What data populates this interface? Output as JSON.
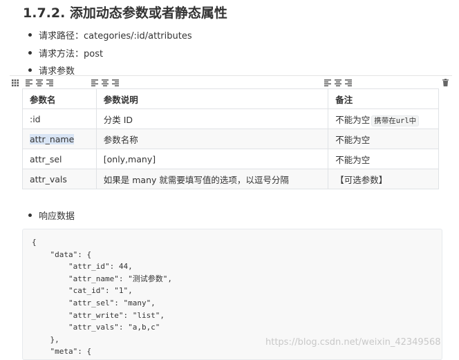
{
  "heading": "1.7.2. 添加动态参数或者静态属性",
  "bullets": {
    "path": "请求路径：categories/:id/attributes",
    "method": "请求方法：post",
    "params": "请求参数",
    "response": "响应数据"
  },
  "table": {
    "headers": [
      "参数名",
      "参数说明",
      "备注"
    ],
    "rows": [
      {
        "name": ":id",
        "desc": "分类 ID",
        "note": "不能为空",
        "note_code": "携带在url中"
      },
      {
        "name": "attr_name",
        "desc": "参数名称",
        "note": "不能为空"
      },
      {
        "name": "attr_sel",
        "desc": "[only,many]",
        "note": "不能为空"
      },
      {
        "name": "attr_vals",
        "desc": "如果是 many 就需要填写值的选项，以逗号分隔",
        "note": "【可选参数】"
      }
    ]
  },
  "code": "{\n    \"data\": {\n        \"attr_id\": 44,\n        \"attr_name\": \"测试参数\",\n        \"cat_id\": \"1\",\n        \"attr_sel\": \"many\",\n        \"attr_write\": \"list\",\n        \"attr_vals\": \"a,b,c\"\n    },\n    \"meta\": {",
  "watermark": "https://blog.csdn.net/weixin_42349568"
}
